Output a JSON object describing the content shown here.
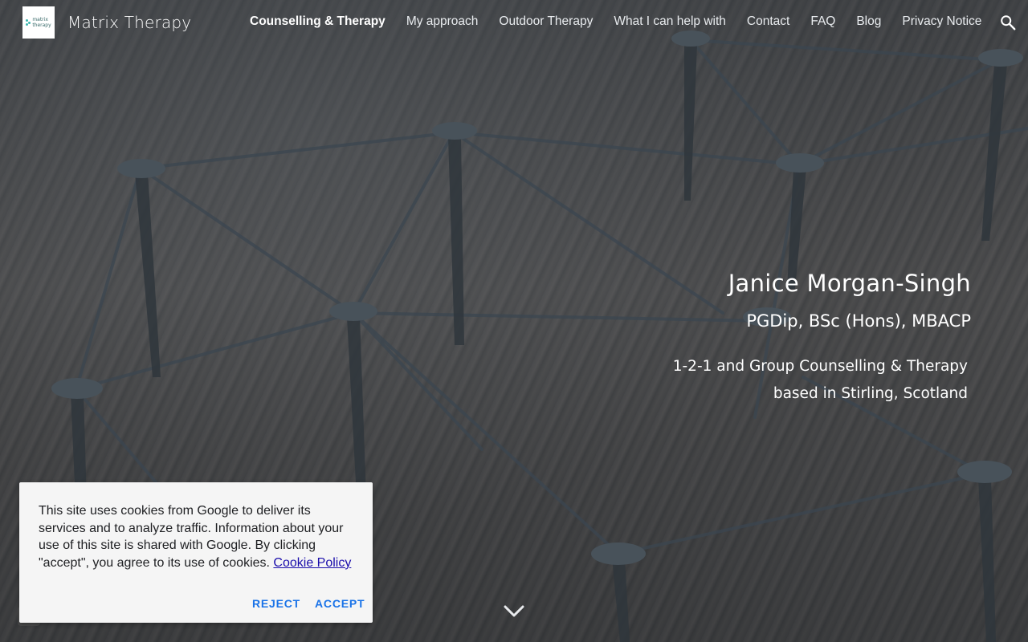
{
  "site": {
    "title": "Matrix Therapy",
    "logo_text_line1": "matrix",
    "logo_text_line2": "therapy"
  },
  "nav": {
    "items": [
      {
        "label": "Counselling & Therapy",
        "active": true
      },
      {
        "label": "My approach",
        "active": false
      },
      {
        "label": "Outdoor Therapy",
        "active": false
      },
      {
        "label": "What I can help with",
        "active": false
      },
      {
        "label": "Contact",
        "active": false
      },
      {
        "label": "FAQ",
        "active": false
      },
      {
        "label": "Blog",
        "active": false
      },
      {
        "label": "Privacy Notice",
        "active": false
      }
    ],
    "search_icon": "search-icon"
  },
  "hero": {
    "name": "Janice Morgan-Singh",
    "qualifications": "PGDip, BSc (Hons), MBACP",
    "description_line1": "1-2-1 and Group Counselling & Therapy",
    "description_line2": "based in Stirling, Scotland",
    "scroll_icon": "chevron-down-icon"
  },
  "cookie_banner": {
    "text": "This site uses cookies from Google to deliver its services and to analyze traffic. Information about your use of this site is shared with Google. By clicking \"accept\", you agree to its use of cookies.",
    "policy_link": "Cookie Policy",
    "reject_label": "REJECT",
    "accept_label": "ACCEPT"
  },
  "colors": {
    "button_accent": "#1a73e8",
    "link": "#1a0dab",
    "logo_accent": "#3fb7b0"
  }
}
